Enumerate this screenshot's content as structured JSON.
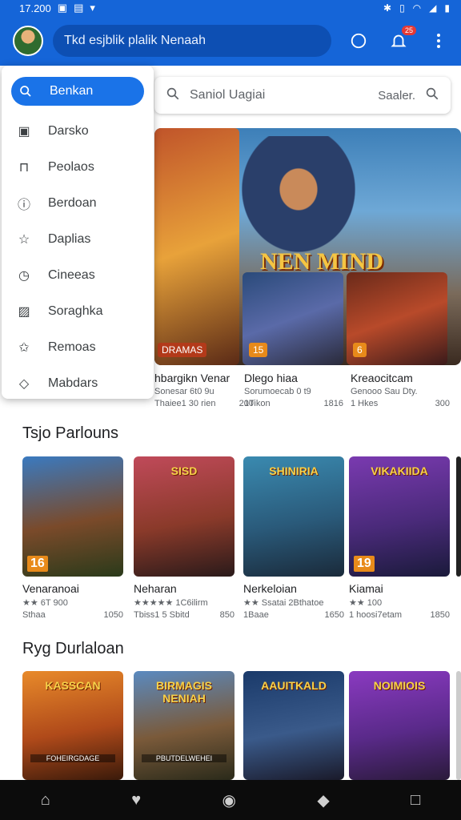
{
  "status_bar": {
    "time": "17.200"
  },
  "app_bar": {
    "search_text": "Tkd esjblik plalik Nenaah",
    "notification_count": "25"
  },
  "drawer": {
    "items": [
      {
        "label": "Benkan",
        "icon": "search-icon"
      },
      {
        "label": "Darsko",
        "icon": "square-icon"
      },
      {
        "label": "Peolaos",
        "icon": "bag-icon"
      },
      {
        "label": "Berdoan",
        "icon": "info-icon"
      },
      {
        "label": "Daplias",
        "icon": "star-icon"
      },
      {
        "label": "Cineeas",
        "icon": "clock-icon"
      },
      {
        "label": "Soraghka",
        "icon": "image-icon"
      },
      {
        "label": "Remoas",
        "icon": "star-outline-icon"
      },
      {
        "label": "Mabdars",
        "icon": "tag-icon"
      }
    ]
  },
  "search_bar": {
    "placeholder": "Saniol Uagiai",
    "trailing": "Saaler."
  },
  "hero": {
    "title": "NEN MIND",
    "cards": [
      {
        "name": "hbargikn Venar",
        "sub1": "Sonesar 6t0 9u",
        "sub2": "Thaiee1 30 rien",
        "sub3": "200",
        "tag": "DRAMAS"
      },
      {
        "name": "Dlego hiaa",
        "sub1": "Sorumoecab 0 t9",
        "sub2": "1Tikon",
        "sub3": "1816",
        "tag": "15"
      },
      {
        "name": "Kreaocitcam",
        "sub1": "Genooo Sau Dty.",
        "sub2": "1 Hkes",
        "sub3": "300",
        "tag": "6"
      }
    ]
  },
  "section1": {
    "title": "Tsjo Parlouns",
    "items": [
      {
        "name": "Venaranoai",
        "rating": "★★ 6T 900",
        "sub": "Sthaa",
        "sub2": "1050",
        "label": "",
        "badge": "16"
      },
      {
        "name": "Neharan",
        "rating": "★★★★★ 1C6ilirm",
        "sub": "Tbiss1 5 Sbitd",
        "sub2": "850",
        "label": "SISD",
        "badge": ""
      },
      {
        "name": "Nerkeloian",
        "rating": "★★ Ssatai 2Bthatoe",
        "sub": "1Baae",
        "sub2": "1650",
        "label": "SHINIRIA",
        "badge": ""
      },
      {
        "name": "Kiamai",
        "rating": "★★ 100",
        "sub": "1 hoosi7etam",
        "sub2": "1850",
        "label": "VIKAKIIDA",
        "badge": "19"
      }
    ]
  },
  "section2": {
    "title": "Ryg Durlaloan",
    "items": [
      {
        "label": "KASSCAN",
        "bottom": "FOHEIRGDAGE"
      },
      {
        "label": "BIRMAGIS NENIAH",
        "bottom": "PBUTDELWEHEI"
      },
      {
        "label": "AAUITKALD",
        "bottom": ""
      },
      {
        "label": "NOIMIOIS",
        "bottom": ""
      }
    ]
  }
}
